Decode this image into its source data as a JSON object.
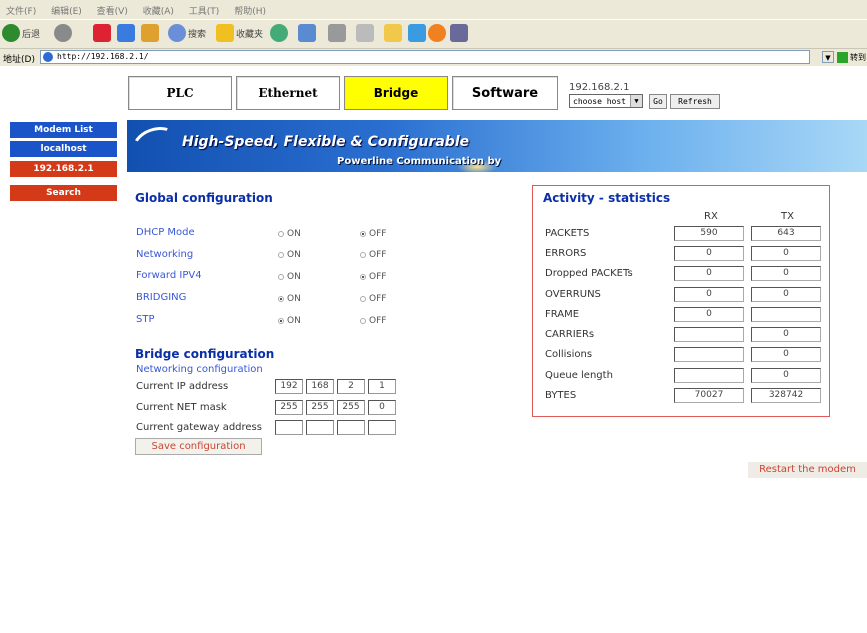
{
  "browser": {
    "menu": [
      "文件(F)",
      "编辑(E)",
      "查看(V)",
      "收藏(A)",
      "工具(T)",
      "帮助(H)"
    ],
    "toolbar": {
      "back": "后退",
      "search": "搜索",
      "favorites": "收藏夹"
    },
    "address_label": "地址(D)",
    "address_value": "http://192.168.2.1/",
    "go_label": "转到"
  },
  "tabs": [
    {
      "label": "PLC"
    },
    {
      "label": "Ethernet"
    },
    {
      "label": "Bridge",
      "active": true
    },
    {
      "label": "Software"
    }
  ],
  "host": {
    "ip": "192.168.2.1",
    "select_value": "choose host",
    "go_label": "Go",
    "refresh_label": "Refresh"
  },
  "sidebar": {
    "items": [
      {
        "label": "Modem List"
      },
      {
        "label": "localhost"
      },
      {
        "label": "192.168.2.1"
      },
      {
        "label": "Search"
      }
    ]
  },
  "banner": {
    "title": "High-Speed, Flexible & Configurable",
    "subtitle": "Powerline Communication by"
  },
  "global": {
    "title": "Global configuration",
    "on_label": "ON",
    "off_label": "OFF",
    "rows": [
      {
        "label": "DHCP Mode",
        "value": "OFF"
      },
      {
        "label": "Networking",
        "value": "OFF"
      },
      {
        "label": "Forward IPV4",
        "value": "OFF"
      },
      {
        "label": "BRIDGING",
        "value": "ON"
      },
      {
        "label": "STP",
        "value": "ON"
      }
    ]
  },
  "bridge": {
    "title": "Bridge configuration",
    "subtitle": "Networking configuration",
    "ip_label": "Current IP address",
    "ip": [
      "192",
      "168",
      "2",
      "1"
    ],
    "mask_label": "Current NET mask",
    "mask": [
      "255",
      "255",
      "255",
      "0"
    ],
    "gateway_label": "Current gateway address",
    "gateway": [
      "",
      "",
      "",
      ""
    ],
    "save_label": "Save configuration"
  },
  "stats": {
    "title": "Activity - statistics",
    "rx_label": "RX",
    "tx_label": "TX",
    "rows": [
      {
        "label": "PACKETS",
        "rx": "590",
        "tx": "643"
      },
      {
        "label": "ERRORS",
        "rx": "0",
        "tx": "0"
      },
      {
        "label": "Dropped PACKETs",
        "rx": "0",
        "tx": "0"
      },
      {
        "label": "OVERRUNS",
        "rx": "0",
        "tx": "0"
      },
      {
        "label": "FRAME",
        "rx": "0",
        "tx": ""
      },
      {
        "label": "CARRIERs",
        "rx": "",
        "tx": "0"
      },
      {
        "label": "Collisions",
        "rx": "",
        "tx": "0"
      },
      {
        "label": "Queue length",
        "rx": "",
        "tx": "0"
      },
      {
        "label": "BYTES",
        "rx": "70027",
        "tx": "328742"
      }
    ]
  },
  "restart_label": "Restart the modem",
  "colors": {
    "accent_blue": "#1a54c8",
    "accent_red": "#d43a18",
    "active_tab": "#ffff00"
  }
}
